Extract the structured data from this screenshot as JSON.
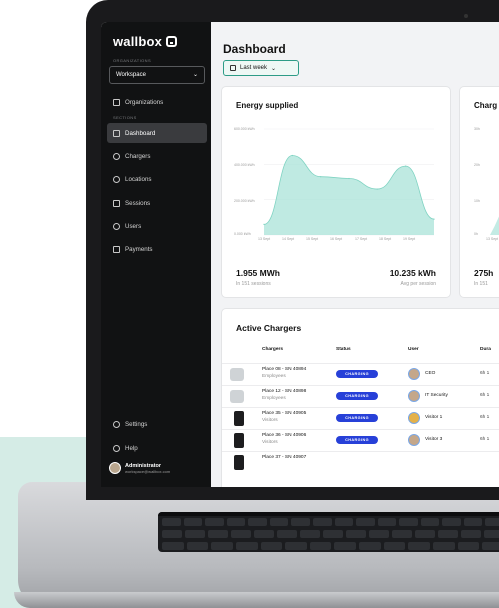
{
  "sidebar": {
    "brand": "wallbox",
    "organizations_label": "ORGANIZATIONS",
    "workspace_value": "Workspace",
    "sections_label": "SECTIONS",
    "items": [
      {
        "label": "Organizations",
        "icon": "building-icon"
      },
      {
        "label": "Dashboard",
        "icon": "dashboard-icon",
        "active": true
      },
      {
        "label": "Chargers",
        "icon": "charger-icon"
      },
      {
        "label": "Locations",
        "icon": "location-pin-icon"
      },
      {
        "label": "Sessions",
        "icon": "sessions-icon"
      },
      {
        "label": "Users",
        "icon": "users-icon"
      },
      {
        "label": "Payments",
        "icon": "card-icon"
      }
    ],
    "settings_label": "Settings",
    "help_label": "Help",
    "profile_name": "Administrator",
    "profile_email": "workspace@wallbox.com"
  },
  "header": {
    "title": "Dashboard",
    "range_label": "Last week"
  },
  "energy_card": {
    "title": "Energy supplied",
    "y_labels": [
      "600.000 kWh",
      "400.000 kWh",
      "200.000 kWh",
      "0.000 kWh"
    ],
    "x_labels": [
      "13 Sept",
      "14 Sept",
      "15 Sept",
      "16 Sept",
      "17 Sept",
      "18 Sept",
      "19 Sept"
    ],
    "total_value": "1.955 MWh",
    "total_sub": "In 151 sessions",
    "avg_value": "10.235 kWh",
    "avg_sub": "Avg per session"
  },
  "charge_card": {
    "title": "Charg",
    "y_labels": [
      "30h",
      "20h",
      "10h",
      "0h"
    ],
    "x_label": "13 Sept",
    "value": "275h",
    "sub": "In 151"
  },
  "chart_data": {
    "type": "area",
    "title": "Energy supplied",
    "x": [
      "13 Sept",
      "14 Sept",
      "15 Sept",
      "16 Sept",
      "17 Sept",
      "18 Sept",
      "19 Sept"
    ],
    "series": [
      {
        "values": [
          60,
          450,
          330,
          320,
          260,
          390,
          90
        ]
      }
    ],
    "ylabel": "",
    "ylim": [
      0,
      600
    ],
    "grid": true,
    "color": "#a9e3d8"
  },
  "active_chargers": {
    "title": "Active Chargers",
    "columns": [
      "Chargers",
      "Status",
      "User",
      "Dura"
    ],
    "rows": [
      {
        "name": "Place 08 - SN 40894",
        "group": "Employees",
        "status": "CHARGING",
        "user": "CEO",
        "duration": "6h 1",
        "type": "wall"
      },
      {
        "name": "Place 12 - SN 40898",
        "group": "Employees",
        "status": "CHARGING",
        "user": "IT Security",
        "duration": "6h 1",
        "type": "wall"
      },
      {
        "name": "Place 35 - SN 40905",
        "group": "Visitors",
        "status": "CHARGING",
        "user": "Visitor 1",
        "duration": "6h 1",
        "type": "tower"
      },
      {
        "name": "Place 36 - SN 40906",
        "group": "Visitors",
        "status": "CHARGING",
        "user": "Visitor 3",
        "duration": "6h 1",
        "type": "tower"
      },
      {
        "name": "Place 37 - SN 40907",
        "group": "",
        "status": "",
        "user": "",
        "duration": "",
        "type": "tower"
      }
    ]
  },
  "colors": {
    "accent": "#2d9c87",
    "status_charging": "#2740d8",
    "sidebar_bg": "#111213",
    "backdrop_mint": "#d5ece6"
  }
}
